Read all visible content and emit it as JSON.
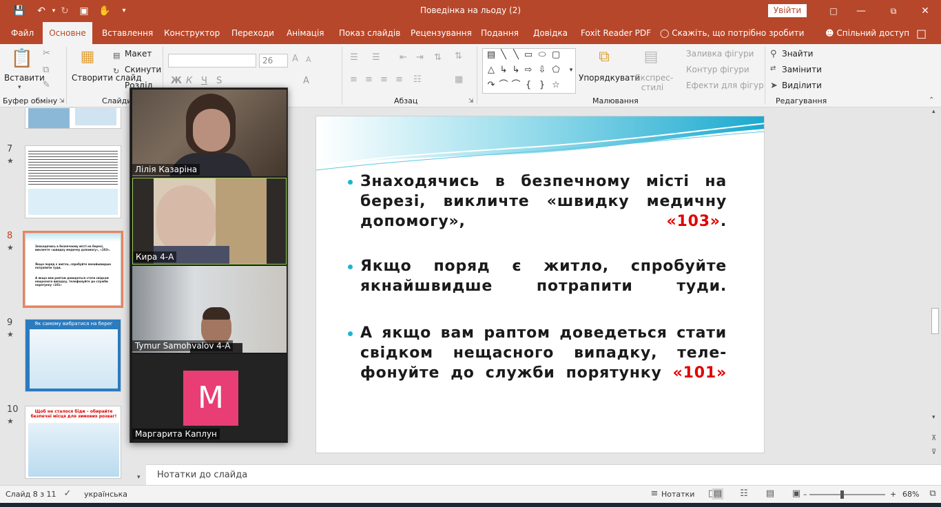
{
  "window": {
    "title": "Поведінка на льоду (2)",
    "signin_label": "Увійти"
  },
  "tabs": [
    {
      "label": "Файл"
    },
    {
      "label": "Основне"
    },
    {
      "label": "Вставлення"
    },
    {
      "label": "Конструктор"
    },
    {
      "label": "Переходи"
    },
    {
      "label": "Анімація"
    },
    {
      "label": "Показ слайдів"
    },
    {
      "label": "Рецензування"
    },
    {
      "label": "Подання"
    },
    {
      "label": "Довідка"
    },
    {
      "label": "Foxit Reader PDF"
    }
  ],
  "tell_me": "Скажіть, що потрібно зробити",
  "share": "Спільний доступ",
  "ribbon": {
    "paste": "Вставити",
    "new_slide": "Створити слайд",
    "layout": "Макет",
    "reset": "Скинути",
    "section": "Розділ",
    "font_size": "26",
    "shape_fill": "Заливка фігури",
    "shape_outline": "Контур фігури",
    "shape_effects": "Ефекти для фігур",
    "arrange": "Упорядкувати",
    "quick_styles": "Експрес-стилі",
    "find": "Знайти",
    "replace": "Замінити",
    "select": "Виділити",
    "groups": {
      "clipboard": "Буфер обміну",
      "slides": "Слайди",
      "paragraph": "Абзац",
      "drawing": "Малювання",
      "editing": "Редагування"
    },
    "font_buttons": {
      "bold": "Ж",
      "italic": "К",
      "underline": "Ч",
      "strike": "S",
      "font_color": "A"
    }
  },
  "thumbnails": [
    {
      "number": "7",
      "star": "★"
    },
    {
      "number": "8",
      "star": "★",
      "active": true,
      "lines": [
        "Знаходячись в безпечному місті на березі, викличте «швидку медичну допомогу», «103».",
        "Якщо поряд є житло, спробуйте якнайшвидше потрапити туди.",
        "А якщо вам раптом доведеться стати свідком нещасного випадку, телефонуйте до служби порятунку «101»"
      ]
    },
    {
      "number": "9",
      "star": "★",
      "title": "Як самому вибратися на берег"
    },
    {
      "number": "10",
      "star": "★",
      "title": "Щоб не сталося біди – обирайте безпечні місця для зимових розваг!"
    }
  ],
  "slide": {
    "bullets": [
      {
        "text": "Знаходячись в безпечному місті на березі, викличте «швидку медичну допомогу», ",
        "red": "«103»",
        "tail": "."
      },
      {
        "text": "Якщо поряд є житло, спробуйте якнайшвидше потрапити туди.",
        "red": "",
        "tail": ""
      },
      {
        "text": "А якщо вам раптом доведеться стати свідком нещасного випадку, теле-фонуйте до служби порятунку ",
        "red": "«101»",
        "tail": ""
      }
    ]
  },
  "video": {
    "participants": [
      {
        "name": "Лілія Казаріна"
      },
      {
        "name": "Кира 4-А"
      },
      {
        "name": "Tymur Samohvalov 4-А"
      },
      {
        "name": "Маргарита Каплун",
        "initial": "M"
      }
    ]
  },
  "notes_placeholder": "Нотатки до слайда",
  "status": {
    "slide_of": "Слайд 8 з 11",
    "language": "українська",
    "notes": "Нотатки",
    "zoom": "68%"
  },
  "colors": {
    "accent": "#b7472a",
    "bullet": "#1cb5cf",
    "highlight": "#e00000",
    "avatar": "#e83e75"
  }
}
